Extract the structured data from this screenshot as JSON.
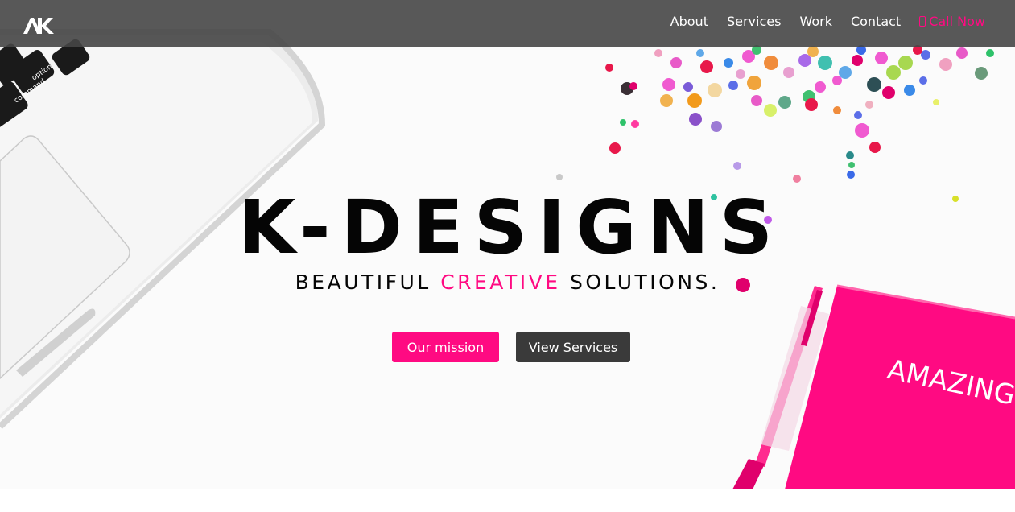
{
  "navbar": {
    "logo_text": "AK",
    "links": [
      {
        "label": "About"
      },
      {
        "label": "Services"
      },
      {
        "label": "Work"
      },
      {
        "label": "Contact"
      }
    ],
    "call": {
      "label": "Call Now",
      "icon": "phone-icon"
    }
  },
  "hero": {
    "title": "K-DESIGNS",
    "subtitle_pre": "BEAUTIFUL ",
    "subtitle_accent": "CREATIVE",
    "subtitle_post": " SOLUTIONS.",
    "notebook_text": "AMAZING",
    "buttons": {
      "mission": "Our mission",
      "services": "View Services"
    }
  },
  "colors": {
    "accent": "#ff0a82",
    "navbar_bg": "#4d4d4d",
    "dark_button": "#3a3a3a",
    "text": "#050505"
  }
}
